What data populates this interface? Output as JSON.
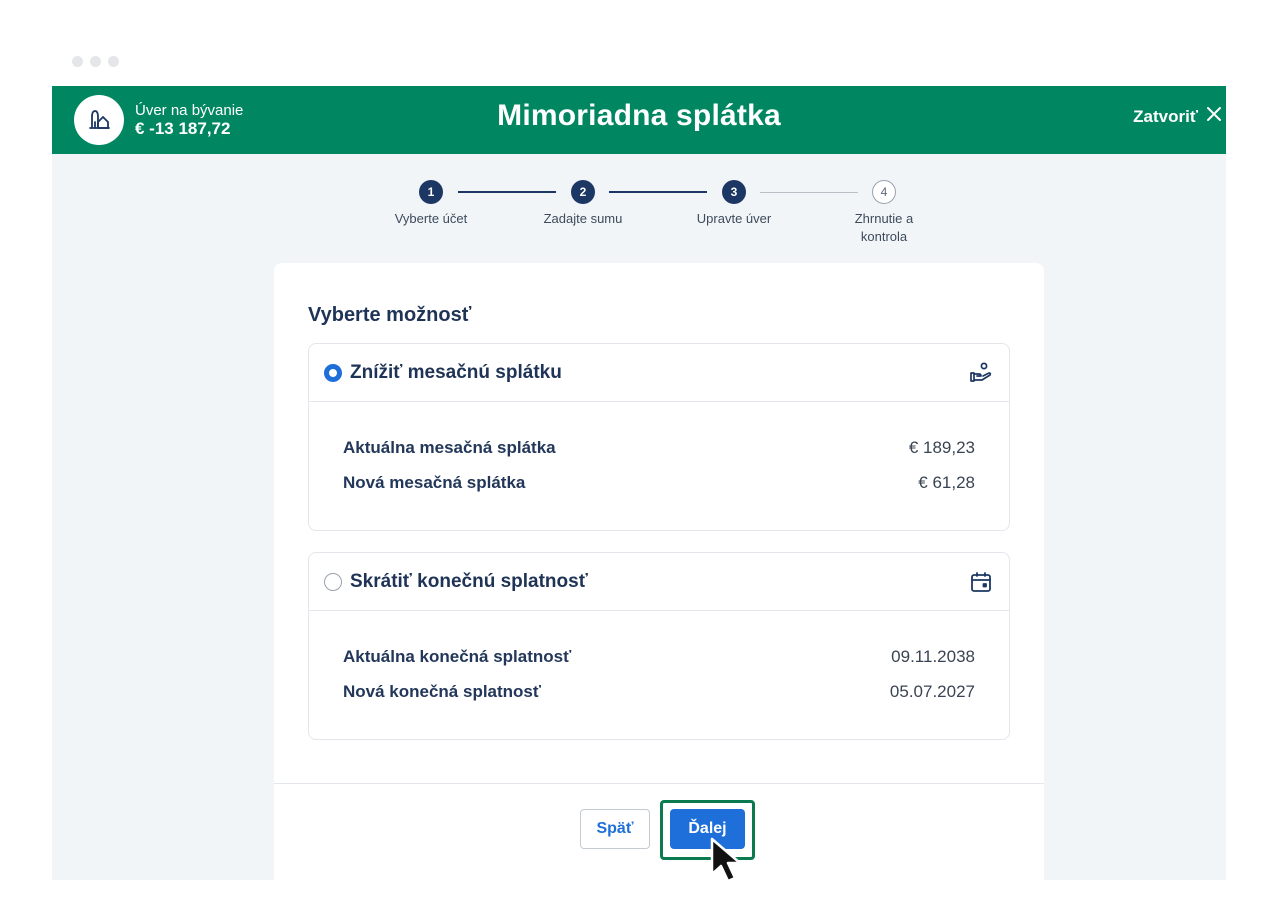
{
  "header": {
    "account_label": "Úver na bývanie",
    "account_amount": "€ -13 187,72",
    "title": "Mimoriadna splátka",
    "close_label": "Zatvoriť",
    "brand_color": "#008761"
  },
  "stepper": {
    "steps": [
      {
        "number": "1",
        "label": "Vyberte účet",
        "status": "done"
      },
      {
        "number": "2",
        "label": "Zadajte sumu",
        "status": "done"
      },
      {
        "number": "3",
        "label": "Upravte úver",
        "status": "current"
      },
      {
        "number": "4",
        "label": "Zhrnutie a kontrola",
        "status": "todo"
      }
    ]
  },
  "card": {
    "title": "Vyberte možnosť",
    "options": [
      {
        "label": "Znížiť mesačnú splátku",
        "selected": true,
        "icon": "hand-coin-icon",
        "rows": [
          {
            "label": "Aktuálna mesačná splátka",
            "value": "€ 189,23"
          },
          {
            "label": "Nová mesačná splátka",
            "value": "€ 61,28"
          }
        ]
      },
      {
        "label": "Skrátiť konečnú splatnosť",
        "selected": false,
        "icon": "calendar-icon",
        "rows": [
          {
            "label": "Aktuálna konečná splatnosť",
            "value": "09.11.2038"
          },
          {
            "label": "Nová konečná splatnosť",
            "value": "05.07.2027"
          }
        ]
      }
    ]
  },
  "footer": {
    "back_label": "Späť",
    "next_label": "Ďalej",
    "accent_color": "#1e6fd9"
  }
}
